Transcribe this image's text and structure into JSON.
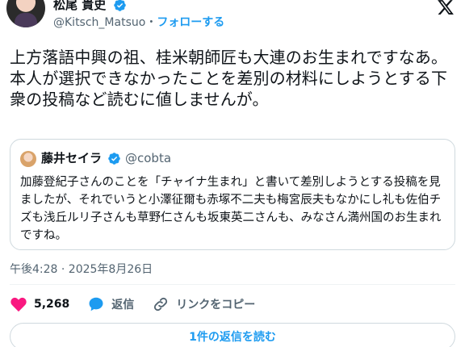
{
  "author": {
    "name": "松尾 貴史",
    "handle": "@Kitsch_Matsuo",
    "separator": "・",
    "follow_label": "フォローする"
  },
  "tweet": {
    "paragraphs": [
      "上方落語中興の祖、桂米朝師匠も大連のお生まれですなあ。",
      "本人が選択できなかったことを差別の材料にしようとする下衆の投稿など読むに値しませんが。"
    ],
    "timestamp": "午後4:28 · 2025年8月26日"
  },
  "quoted_tweet": {
    "name": "藤井セイラ",
    "handle": "@cobta",
    "paragraphs": [
      "加藤登紀子さんのことを「チャイナ生まれ」と書いて差別しようとする投稿を見ましたが、それでいうと小澤征爾も赤塚不二夫も梅宮辰夫もなかにし礼も佐伯チズも浅丘ルリ子さんも草野仁さんも坂東英二さんも、みなさん満州国のお生まれですね。"
    ]
  },
  "actions": {
    "like_count": "5,268",
    "reply_label": "返信",
    "copy_link_label": "リンクをコピー"
  },
  "read_replies_label": "1件の返信を読む",
  "colors": {
    "accent": "#1d9bf0",
    "like": "#f91880",
    "muted": "#536471"
  },
  "icons": [
    "verified-badge-icon",
    "x-logo-icon",
    "heart-icon",
    "reply-bubble-icon",
    "link-icon"
  ]
}
